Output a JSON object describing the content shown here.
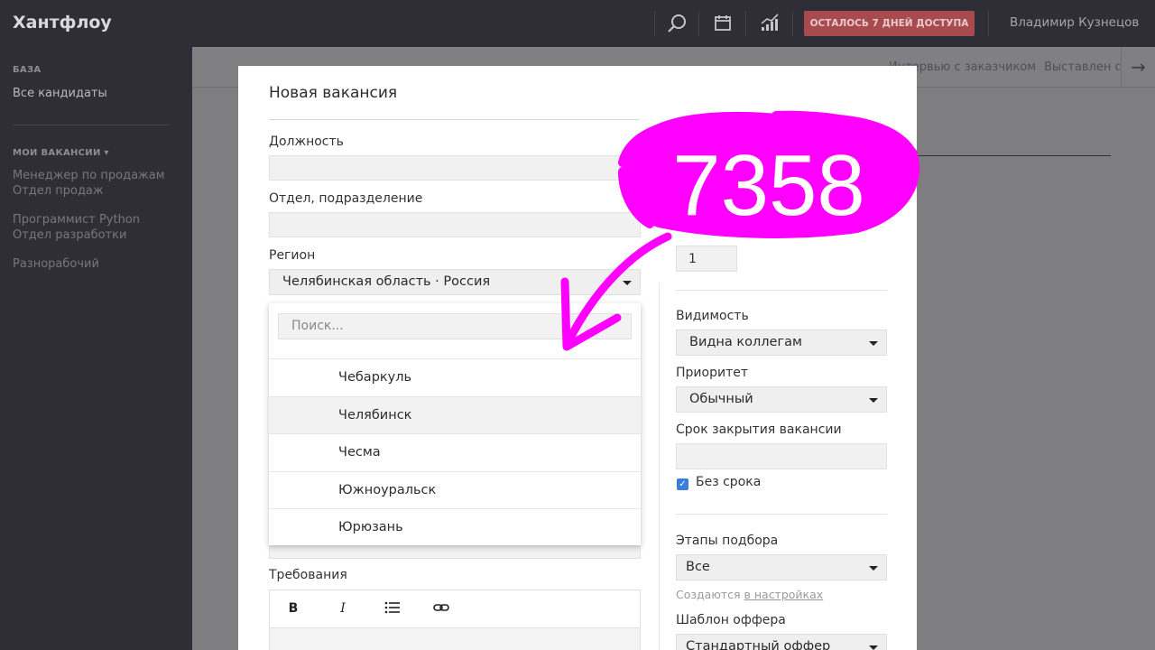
{
  "app": {
    "logo": "Хантфлоу"
  },
  "topbar": {
    "access_button": "ОСТАЛОСЬ 7 ДНЕЙ ДОСТУПА",
    "user_name": "Владимир Кузнецов",
    "icons": [
      "search-icon",
      "calendar-icon",
      "analytics-icon"
    ]
  },
  "sidebar": {
    "base_heading": "БАЗА",
    "all_candidates": "Все кандидаты",
    "vacancies_heading": "МОИ ВАКАНСИИ ▾",
    "vacancies": [
      {
        "title": "Менеджер по продажам",
        "dept": "Отдел продаж"
      },
      {
        "title": "Программист Python",
        "dept": "Отдел разработки"
      },
      {
        "title": "Разнорабочий",
        "dept": ""
      }
    ]
  },
  "bg_tabs": [
    "Интервью с заказчиком",
    "Выставлен о"
  ],
  "modal": {
    "title": "Новая вакансия",
    "position_label": "Должность",
    "department_label": "Отдел, подразделение",
    "region_label": "Регион",
    "region_value": "Челябинская область · Россия",
    "requirements_label": "Требования",
    "people_count_value": "1",
    "visibility_label": "Видимость",
    "visibility_value": "Видна коллегам",
    "priority_label": "Приоритет",
    "priority_value": "Обычный",
    "deadline_label": "Срок закрытия вакансии",
    "no_deadline_label": "Без срока",
    "no_deadline_checked": true,
    "stages_label": "Этапы подбора",
    "stages_value": "Все",
    "stages_hint_prefix": "Создаются",
    "stages_hint_link": "в настройках",
    "offer_label": "Шаблон оффера",
    "offer_value": "Стандартный оффер"
  },
  "region_dropdown": {
    "search_placeholder": "Поиск...",
    "items": [
      "Чебаркуль",
      "Челябинск",
      "Чесма",
      "Южноуральск",
      "Юрюзань"
    ],
    "highlighted": "Челябинск"
  },
  "annotation": {
    "number": "7358",
    "color": "#ff00ff"
  }
}
